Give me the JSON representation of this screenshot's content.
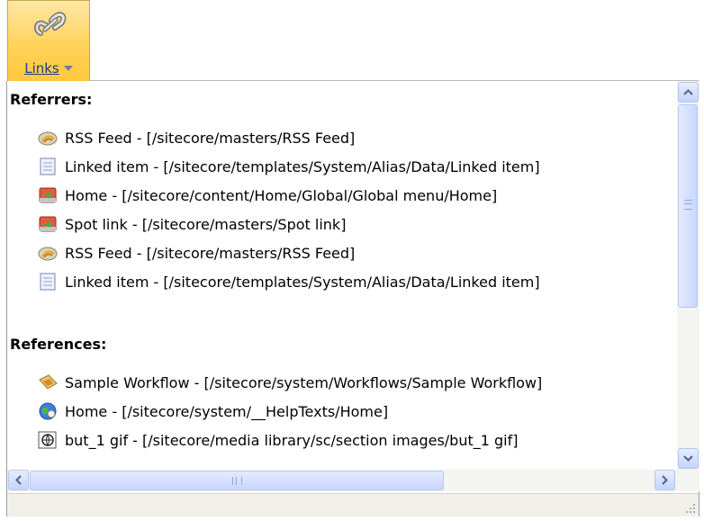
{
  "toolbar": {
    "links_label": "Links"
  },
  "referrers": {
    "heading": "Referrers:",
    "items": [
      {
        "icon": "rss-feed-icon",
        "text": "RSS Feed - [/sitecore/masters/RSS Feed]"
      },
      {
        "icon": "document-icon",
        "text": "Linked item - [/sitecore/templates/System/Alias/Data/Linked item]"
      },
      {
        "icon": "home-link-icon",
        "text": "Home - [/sitecore/content/Home/Global/Global menu/Home]"
      },
      {
        "icon": "spot-link-icon",
        "text": "Spot link - [/sitecore/masters/Spot link]"
      },
      {
        "icon": "rss-feed-icon",
        "text": "RSS Feed - [/sitecore/masters/RSS Feed]"
      },
      {
        "icon": "document-icon",
        "text": "Linked item - [/sitecore/templates/System/Alias/Data/Linked item]"
      }
    ]
  },
  "references": {
    "heading": "References:",
    "items": [
      {
        "icon": "workflow-icon",
        "text": "Sample Workflow - [/sitecore/system/Workflows/Sample Workflow]"
      },
      {
        "icon": "help-globe-icon",
        "text": "Home - [/sitecore/system/__HelpTexts/Home]"
      },
      {
        "icon": "media-image-icon",
        "text": "but_1 gif - [/sitecore/media library/sc/section images/but_1 gif]"
      }
    ]
  },
  "colors": {
    "button_gradient_top": "#ffe8a6",
    "button_gradient_bottom": "#ffc93d",
    "link_blue": "#1c3a8c",
    "scroll_blue": "#c4d4fb"
  }
}
